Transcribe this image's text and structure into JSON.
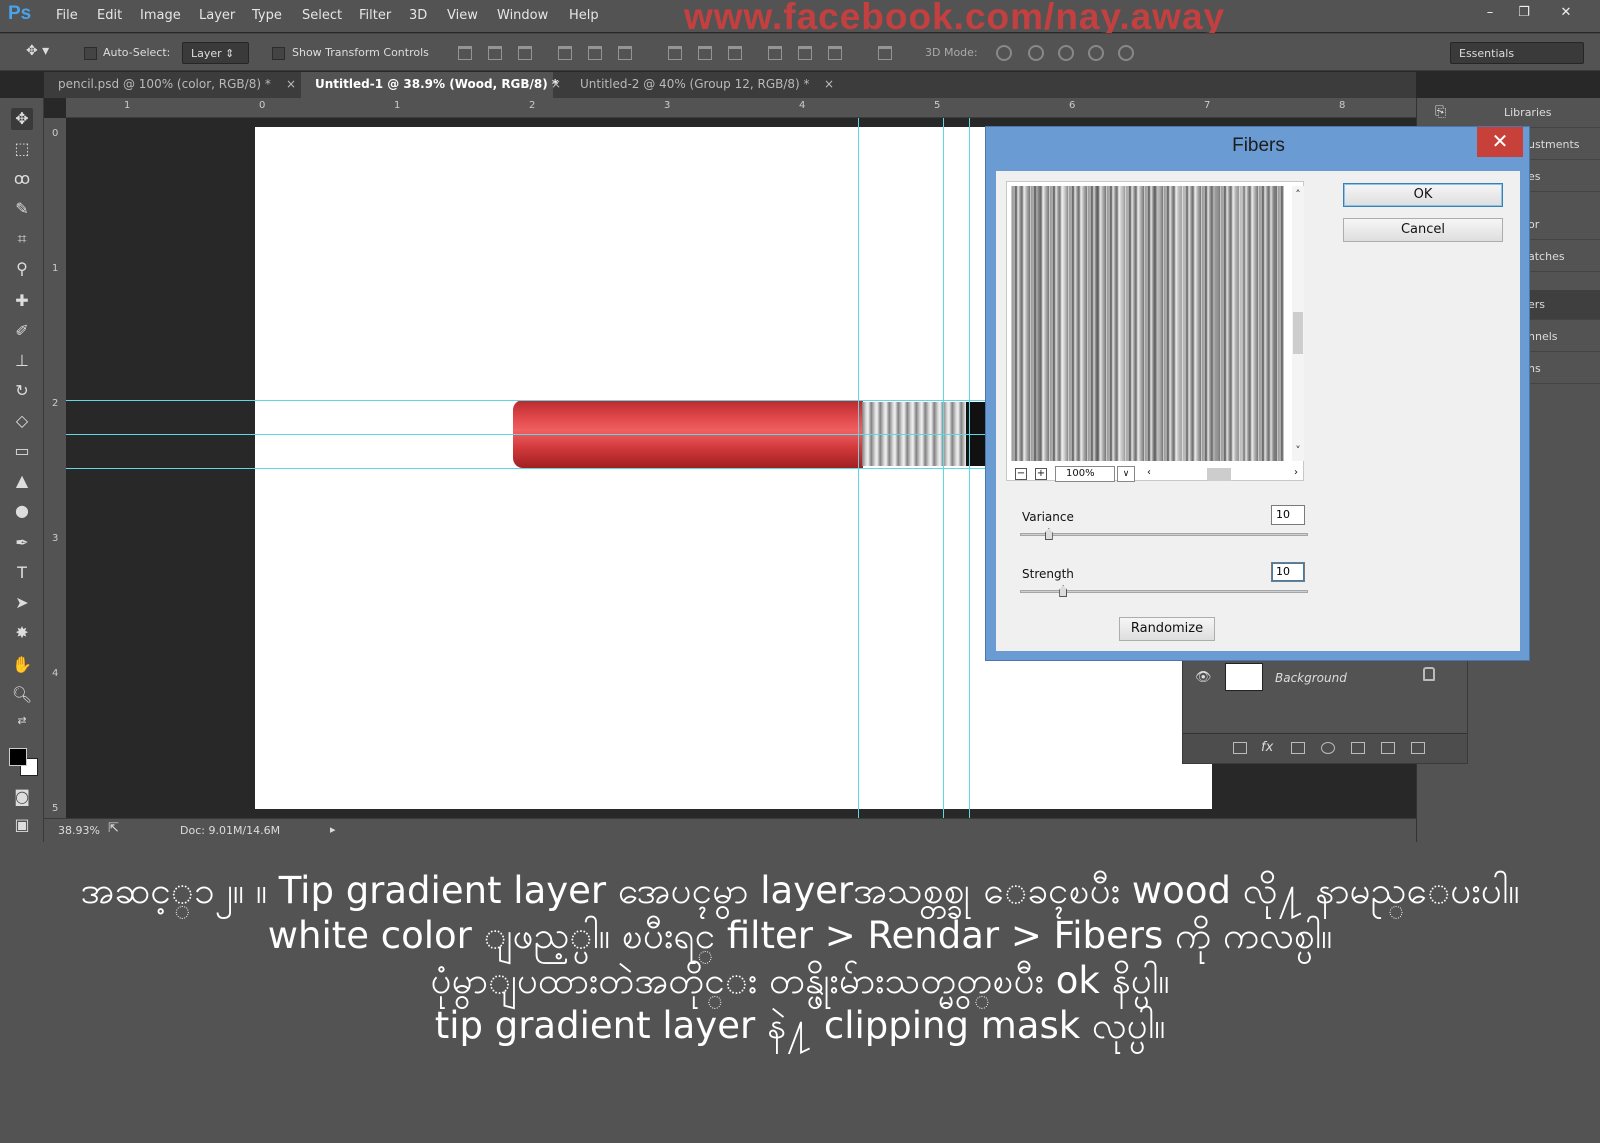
{
  "menubar": {
    "logo": "Ps",
    "items": [
      "File",
      "Edit",
      "Image",
      "Layer",
      "Type",
      "Select",
      "Filter",
      "3D",
      "View",
      "Window",
      "Help"
    ],
    "watermark": "www.facebook.com/nay.away",
    "window_buttons": [
      "–",
      "❐",
      "✕"
    ]
  },
  "options": {
    "auto_select_label": "Auto-Select:",
    "auto_select_value": "Layer",
    "show_transform_label": "Show Transform Controls",
    "mode_3d_label": "3D Mode:",
    "workspace": "Essentials"
  },
  "tabs": [
    {
      "label": "pencil.psd @ 100% (color, RGB/8) *",
      "active": false
    },
    {
      "label": "Untitled-1 @ 38.9% (Wood, RGB/8) *",
      "active": true
    },
    {
      "label": "Untitled-2 @ 40% (Group 12, RGB/8) *",
      "active": false
    }
  ],
  "ruler_top": [
    "1",
    "0",
    "1",
    "2",
    "3",
    "4",
    "5",
    "6",
    "7",
    "8"
  ],
  "ruler_left": [
    "0",
    "1",
    "2",
    "3",
    "4",
    "5"
  ],
  "status": {
    "zoom": "38.93%",
    "doc": "Doc: 9.01M/14.6M"
  },
  "panels": [
    "Libraries",
    "ustments",
    "es",
    "or",
    "atches",
    "ers",
    "nnels",
    "hs"
  ],
  "layers": {
    "background_name": "Background"
  },
  "dialog": {
    "title": "Fibers",
    "close": "✕",
    "ok": "OK",
    "cancel": "Cancel",
    "zoom": "100%",
    "variance_label": "Variance",
    "variance_value": "10",
    "variance_pct": 10,
    "strength_label": "Strength",
    "strength_value": "10",
    "strength_pct": 15,
    "randomize": "Randomize"
  },
  "caption": {
    "line1": "အဆင့္၁၂။ ။ Tip gradient layer အေပၚမွာ layerအသစ္တစ္ခု ေခၚၿပီး wood လို႔ နာမည္ေပးပါ။",
    "line2": "white color ျဖည့္ပါ။ ၿပီးရင္ filter > Rendar > Fibers ကို ကလစ္ပါ။",
    "line3": "ပုံမွာျပထားတဲအတိုင္း တန္ဖိုးမ်ားသတ္မွတ္ၿပီး ok နိပ္ပါ။",
    "line4": "tip gradient layer နဲ႔ clipping mask လုပ္ပါ။"
  },
  "colors": {
    "pencil_red": "#e0474a",
    "guide": "#5fd7e5",
    "dialog_frame": "#6a9bd3",
    "close_red": "#c7403a"
  }
}
